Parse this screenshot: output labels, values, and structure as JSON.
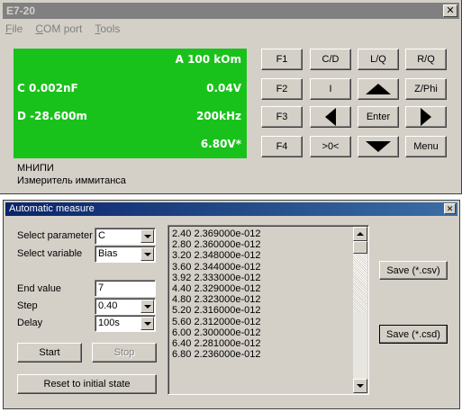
{
  "main_window": {
    "title": "E7-20",
    "close_glyph": "✕",
    "menu": [
      {
        "label": "File",
        "accel": "F",
        "rest": "ile"
      },
      {
        "label": "COM port",
        "accel": "C",
        "rest": "OM port"
      },
      {
        "label": "Tools",
        "accel": "T",
        "rest": "ools"
      }
    ],
    "display": {
      "row1_right": "A 100 kOm",
      "row2_left": "C 0.002nF",
      "row2_right": "0.04V",
      "row3_left": "D -28.600m",
      "row3_right": "200kHz",
      "row4_right": "6.80V*",
      "background_color": "#19c21b"
    },
    "brand_line1": "МНИПИ",
    "brand_line2": "Измеритель иммитанса",
    "buttons": {
      "f1": "F1",
      "cd": "C/D",
      "lq": "L/Q",
      "rq": "R/Q",
      "f2": "F2",
      "i": "I",
      "up": "up-arrow-icon",
      "zphi": "Z/Phi",
      "f3": "F3",
      "left": "left-arrow-icon",
      "enter": "Enter",
      "right": "right-arrow-icon",
      "f4": "F4",
      "zero": ">0<",
      "down": "down-arrow-icon",
      "menu": "Menu"
    }
  },
  "sub_window": {
    "title": "Automatic measure",
    "close_glyph": "✕",
    "select_parameter_label": "Select parameter",
    "select_parameter_value": "C",
    "select_variable_label": "Select variable",
    "select_variable_value": "Bias",
    "end_value_label": "End value",
    "end_value": "7",
    "step_label": "Step",
    "step_value": "0.40",
    "delay_label": "Delay",
    "delay_value": "100s",
    "start_label": "Start",
    "stop_label": "Stop",
    "reset_label": "Reset to initial state",
    "save_csv_label": "Save (*.csv)",
    "save_csd_label": "Save (*.csd)",
    "results": [
      "2.40 2.369000e-012",
      "2.80 2.360000e-012",
      "3.20 2.348000e-012",
      "3.60 2.344000e-012",
      "3.92 2.333000e-012",
      "4.40 2.329000e-012",
      "4.80 2.323000e-012",
      "5.20 2.316000e-012",
      "5.60 2.312000e-012",
      "6.00 2.300000e-012",
      "6.40 2.281000e-012",
      "6.80 2.236000e-012"
    ]
  }
}
